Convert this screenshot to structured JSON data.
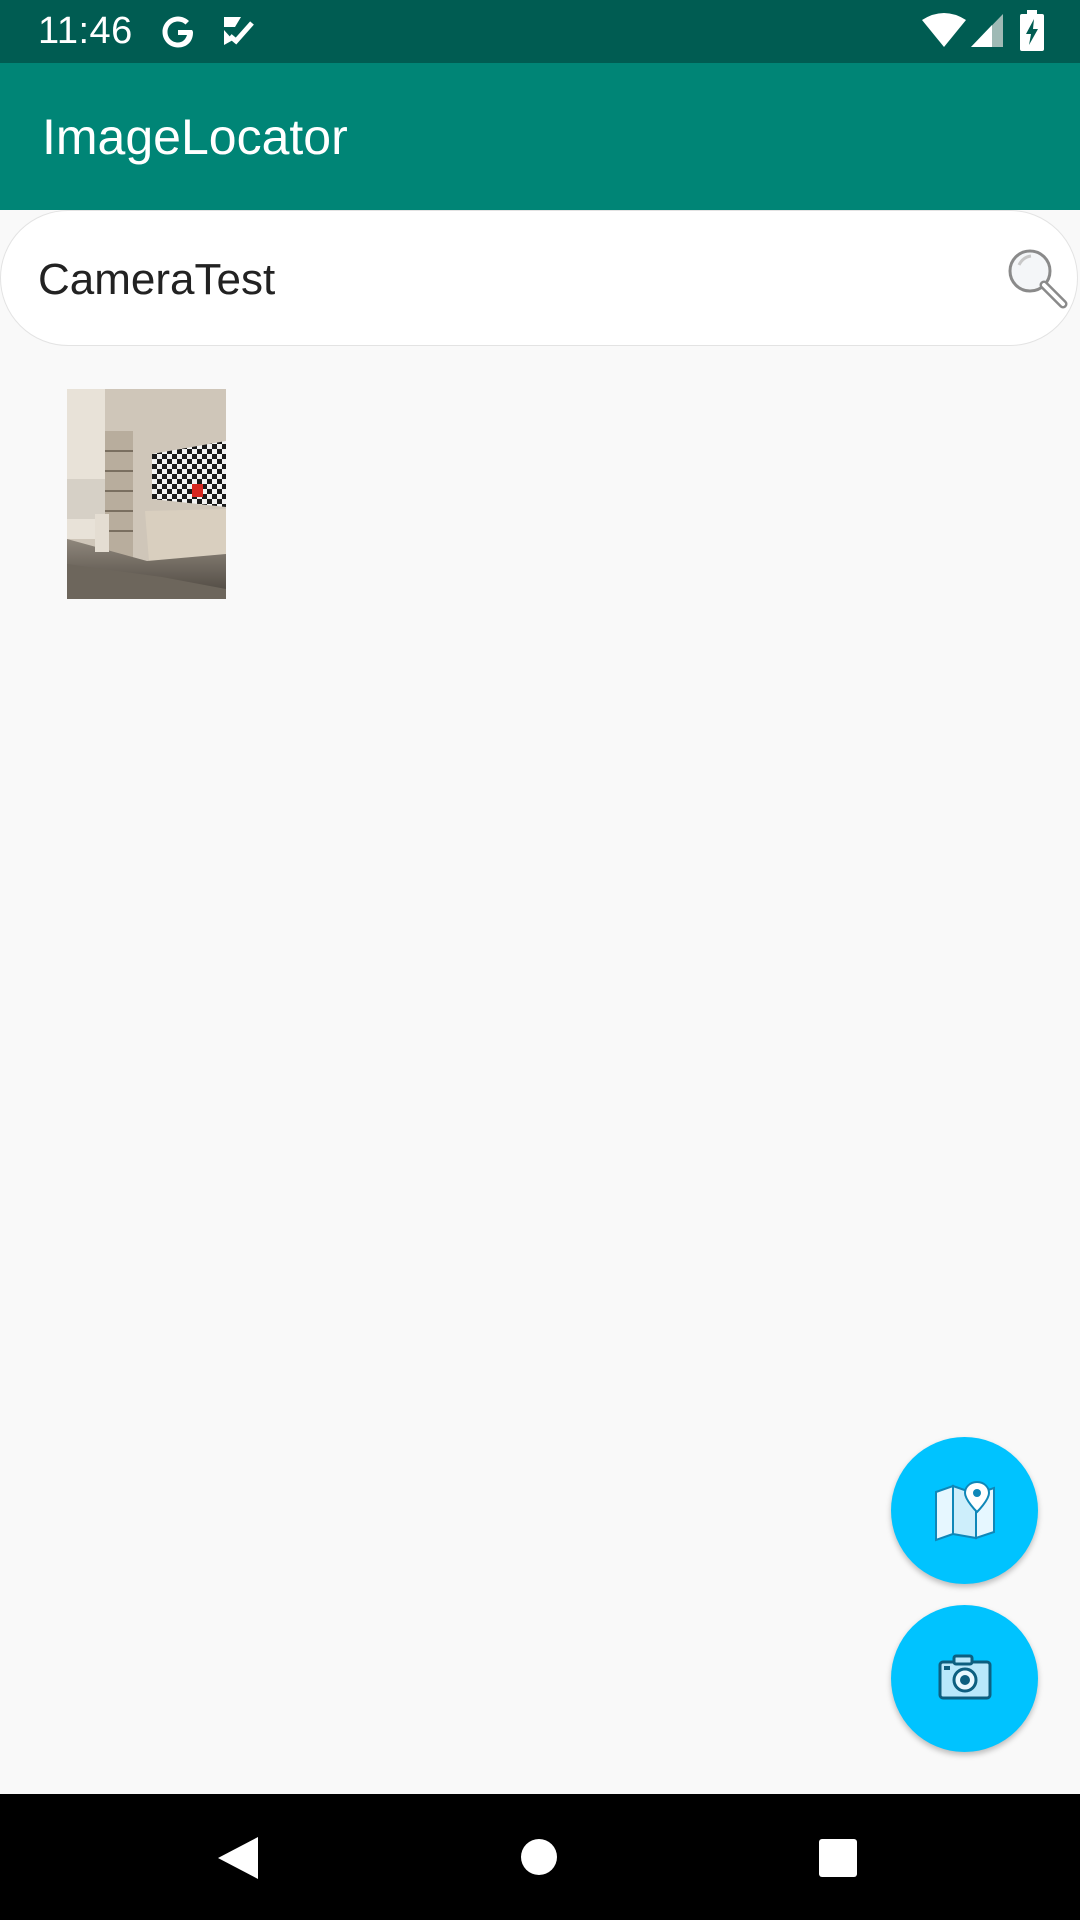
{
  "status_bar": {
    "time": "11:46",
    "icons": [
      "google-g-icon",
      "task-check-icon",
      "wifi-icon",
      "cell-signal-icon",
      "battery-charging-icon"
    ]
  },
  "app_bar": {
    "title": "ImageLocator",
    "color": "#008576"
  },
  "search": {
    "value": "CameraTest",
    "icon": "search-icon"
  },
  "gallery": {
    "items": [
      {
        "type": "photo-thumbnail"
      }
    ]
  },
  "fabs": {
    "map_icon": "map-icon",
    "camera_icon": "camera-icon",
    "color": "#00c3ff"
  },
  "nav_bar": {
    "icons": [
      "back-icon",
      "home-icon",
      "recents-icon"
    ]
  }
}
